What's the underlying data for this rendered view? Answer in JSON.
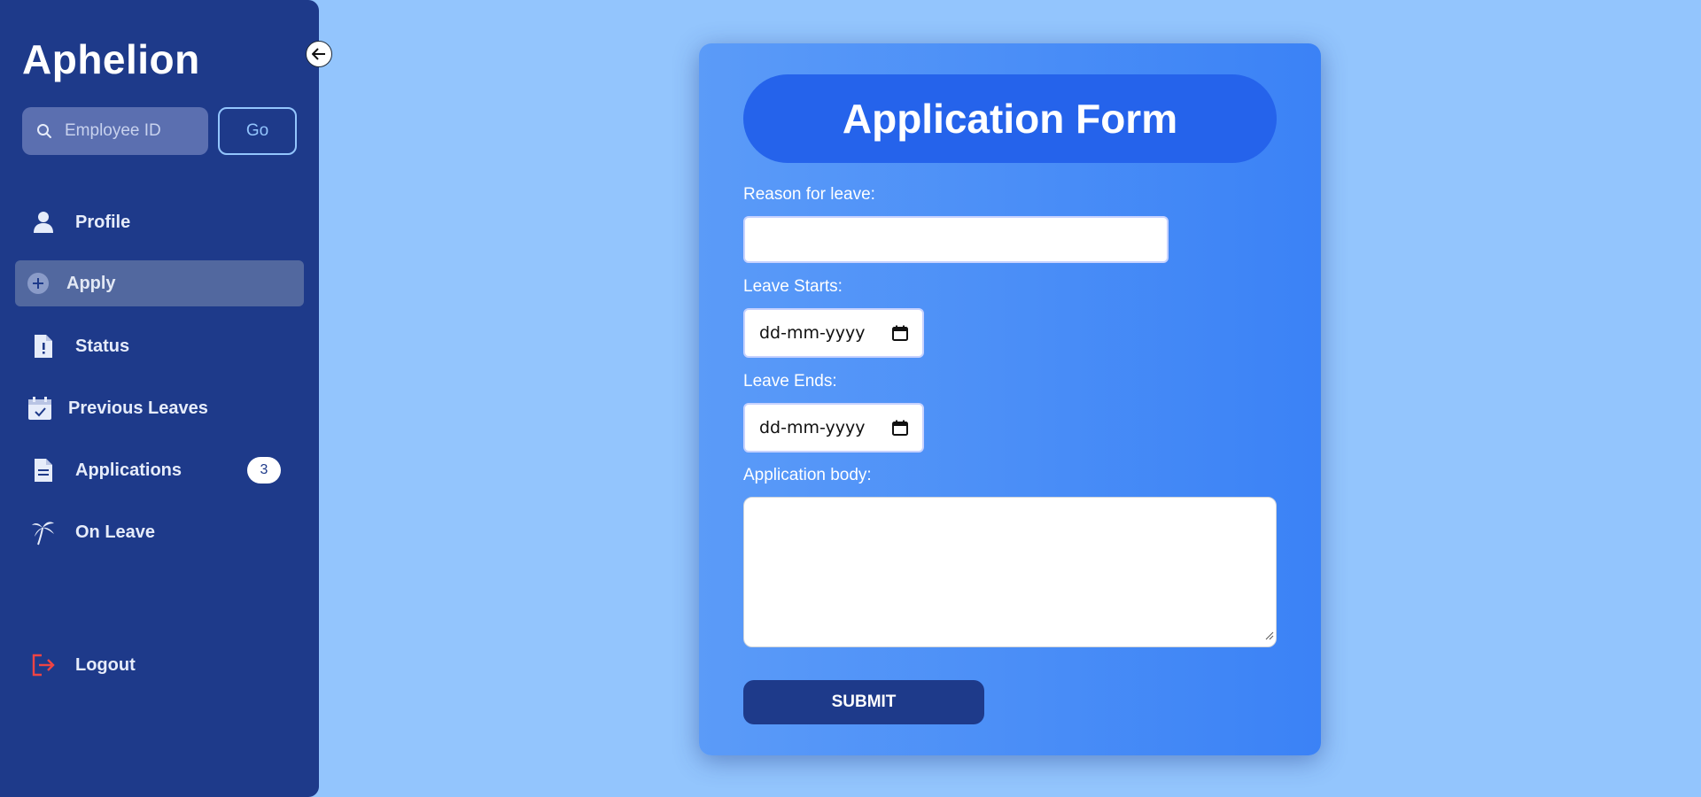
{
  "sidebar": {
    "app_title": "Aphelion",
    "search": {
      "placeholder": "Employee ID",
      "value": ""
    },
    "go_label": "Go",
    "nav": {
      "profile": "Profile",
      "apply": "Apply",
      "status": "Status",
      "previous_leaves": "Previous Leaves",
      "applications": "Applications",
      "applications_badge": "3",
      "on_leave": "On Leave",
      "logout": "Logout"
    }
  },
  "form": {
    "title": "Application Form",
    "reason_label": "Reason for leave:",
    "reason_value": "",
    "start_label": "Leave Starts:",
    "start_placeholder": "dd-mm-yyyy",
    "end_label": "Leave Ends:",
    "end_placeholder": "dd-mm-yyyy",
    "body_label": "Application body:",
    "body_value": "",
    "submit_label": "SUBMIT"
  },
  "colors": {
    "sidebar_bg": "#1e3a8a",
    "page_bg": "#93c5fd",
    "card_header": "#2563eb",
    "logout_icon": "#ef4444"
  },
  "icons": {
    "search": "search-icon",
    "collapse": "arrow-left-icon",
    "profile": "user-icon",
    "apply": "plus-circle-icon",
    "status": "file-alert-icon",
    "previous_leaves": "calendar-check-icon",
    "applications": "document-icon",
    "on_leave": "palm-tree-icon",
    "logout": "logout-icon",
    "calendar": "calendar-icon"
  }
}
